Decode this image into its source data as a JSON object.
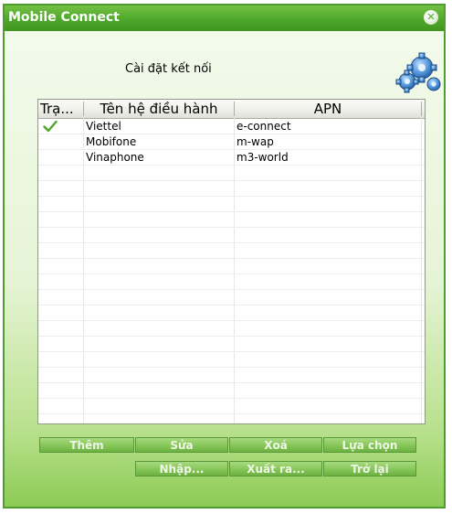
{
  "window": {
    "title": "Mobile Connect",
    "close_symbol": "✕"
  },
  "heading": "Cài đặt kết nối",
  "icons": {
    "header": "gears-icon",
    "status": "check-icon",
    "close": "close-icon"
  },
  "table": {
    "columns": [
      "Trạ...",
      "Tên hệ điều hành",
      "APN"
    ],
    "rows": [
      {
        "status": "selected",
        "name": "Viettel",
        "apn": "e-connect"
      },
      {
        "status": "",
        "name": "Mobifone",
        "apn": "m-wap"
      },
      {
        "status": "",
        "name": "Vinaphone",
        "apn": "m3-world"
      }
    ]
  },
  "buttons": {
    "add": "Thêm",
    "edit": "Sửa",
    "delete": "Xoá",
    "select": "Lựa chọn",
    "import": "Nhập...",
    "export": "Xuất ra...",
    "back": "Trở lại"
  },
  "colors": {
    "title_bar": "#4ea82a",
    "button": "#86c658",
    "check": "#4fa82c"
  }
}
